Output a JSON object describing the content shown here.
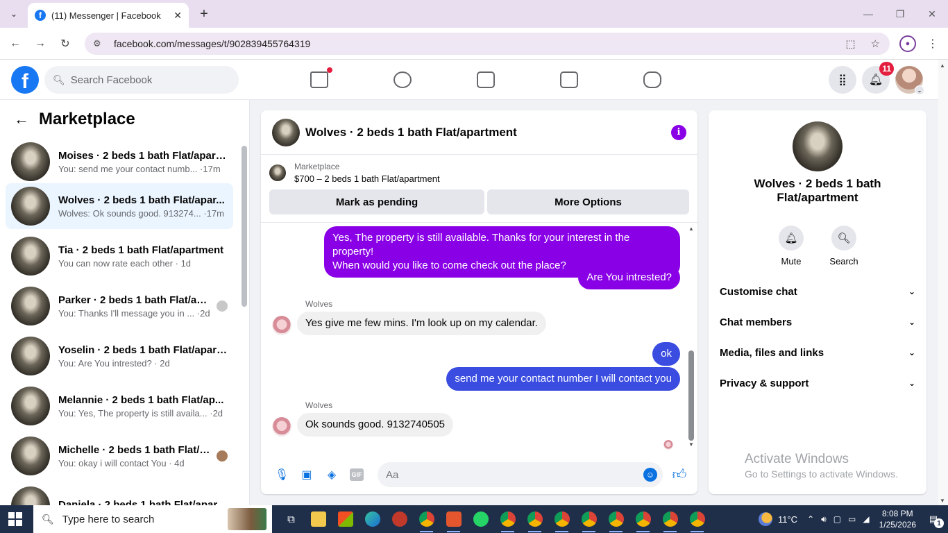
{
  "browser": {
    "tab_title": "(11) Messenger | Facebook",
    "url": "facebook.com/messages/t/902839455764319"
  },
  "fb": {
    "search_placeholder": "Search Facebook",
    "notification_count": "11"
  },
  "left": {
    "title": "Marketplace",
    "conversations": [
      {
        "name": "Moises · 2 beds 1 bath Flat/apart...",
        "snippet": "You: send me your contact numb... ·17m"
      },
      {
        "name": "Wolves · 2 beds 1 bath Flat/apar...",
        "snippet": "Wolves: Ok sounds good. 913274... ·17m"
      },
      {
        "name": "Tia · 2 beds 1 bath Flat/apartment",
        "snippet": "You can now rate each other · 1d"
      },
      {
        "name": "Parker · 2 beds 1 bath Flat/apa...",
        "snippet": "You: Thanks I'll message you in ... ·2d"
      },
      {
        "name": "Yoselin · 2 beds 1 bath Flat/apart...",
        "snippet": "You: Are You intrested? · 2d"
      },
      {
        "name": "Melannie · 2 beds 1 bath Flat/ap...",
        "snippet": "You: Yes, The property is still availa... ·2d"
      },
      {
        "name": "Michelle · 2 beds 1 bath Flat/a...",
        "snippet": "You: okay i will contact You · 4d"
      },
      {
        "name": "Daniela · 2 beds 1 bath Flat/apar...",
        "snippet": ""
      }
    ]
  },
  "chat": {
    "title": "Wolves · 2 beds 1 bath Flat/apartment",
    "listing_category": "Marketplace",
    "listing_price": "$700 – 2 beds 1 bath Flat/apartment",
    "mark_pending": "Mark as pending",
    "more_options": "More Options",
    "messages": {
      "m1_line1": "Yes, The property is still available. Thanks for your interest in the property!",
      "m1_line2": "When would you like to come check out the place?",
      "m2": "Are You intrested?",
      "sender1": "Wolves",
      "m3": "Yes give me few mins. I'm look up on my calendar.",
      "m4": "ok",
      "m5": "send me your contact number I will contact you",
      "sender2": "Wolves",
      "m6": "Ok sounds good. 9132740505"
    },
    "input_placeholder": "Aa",
    "gif_label": "GIF"
  },
  "right": {
    "name": "Wolves · 2 beds 1 bath Flat/apartment",
    "mute": "Mute",
    "search": "Search",
    "sections": [
      "Customise chat",
      "Chat members",
      "Media, files and links",
      "Privacy & support"
    ],
    "activate_title": "Activate Windows",
    "activate_sub": "Go to Settings to activate Windows."
  },
  "taskbar": {
    "search_placeholder": "Type here to search",
    "temp": "11°C",
    "time": "8:08 PM",
    "date": "1/25/2026",
    "notif_count": "1"
  }
}
